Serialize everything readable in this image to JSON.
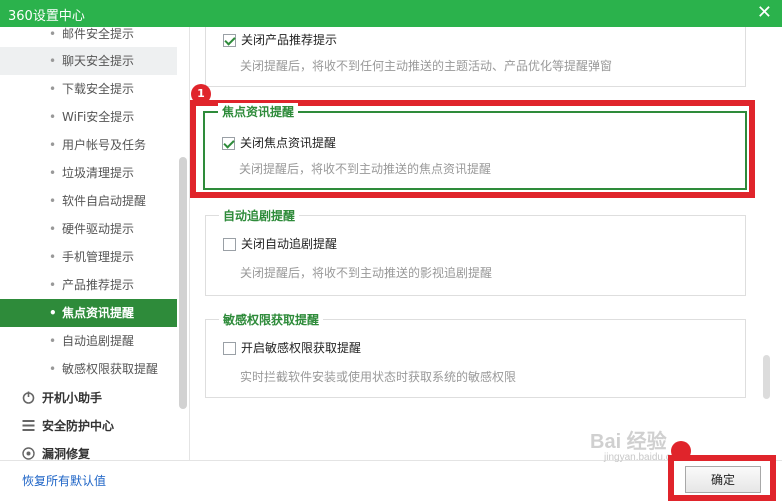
{
  "window": {
    "title": "360设置中心",
    "close_glyph": "✕"
  },
  "sidebar": {
    "items": [
      {
        "label": "邮件安全提示",
        "state": "normal"
      },
      {
        "label": "聊天安全提示",
        "state": "hover"
      },
      {
        "label": "下载安全提示",
        "state": "normal"
      },
      {
        "label": "WiFi安全提示",
        "state": "normal"
      },
      {
        "label": "用户帐号及任务",
        "state": "normal"
      },
      {
        "label": "垃圾清理提示",
        "state": "normal"
      },
      {
        "label": "软件自启动提醒",
        "state": "normal"
      },
      {
        "label": "硬件驱动提示",
        "state": "normal"
      },
      {
        "label": "手机管理提示",
        "state": "normal"
      },
      {
        "label": "产品推荐提示",
        "state": "normal"
      },
      {
        "label": "焦点资讯提醒",
        "state": "active"
      },
      {
        "label": "自动追剧提醒",
        "state": "normal"
      },
      {
        "label": "敏感权限获取提醒",
        "state": "normal"
      }
    ],
    "groups": [
      {
        "label": "开机小助手",
        "icon": "power-icon"
      },
      {
        "label": "安全防护中心",
        "icon": "shield-list-icon"
      },
      {
        "label": "漏洞修复",
        "icon": "patch-icon"
      }
    ]
  },
  "footer": {
    "restore_defaults": "恢复所有默认值",
    "ok_button": "确定"
  },
  "sections": {
    "product": {
      "checkbox_label": "关闭产品推荐提示",
      "checked": true,
      "desc": "关闭提醒后，将收不到任何主动推送的主题活动、产品优化等提醒弹窗"
    },
    "focus": {
      "legend": "焦点资讯提醒",
      "checkbox_label": "关闭焦点资讯提醒",
      "checked": true,
      "desc": "关闭提醒后，将收不到主动推送的焦点资讯提醒"
    },
    "drama": {
      "legend": "自动追剧提醒",
      "checkbox_label": "关闭自动追剧提醒",
      "checked": false,
      "desc": "关闭提醒后，将收不到主动推送的影视追剧提醒"
    },
    "sensitive": {
      "legend": "敏感权限获取提醒",
      "checkbox_label": "开启敏感权限获取提醒",
      "checked": false,
      "desc": "实时拦截软件安装或使用状态时获取系统的敏感权限"
    }
  },
  "annotations": {
    "badge_1": "1"
  },
  "watermark": {
    "text": "Bai 经验",
    "sub": "jingyan.baidu.com"
  },
  "colors": {
    "brand_green": "#2bb24c",
    "active_green": "#2e8b3a",
    "highlight_red": "#e0242b",
    "link_blue": "#1c63c6"
  }
}
